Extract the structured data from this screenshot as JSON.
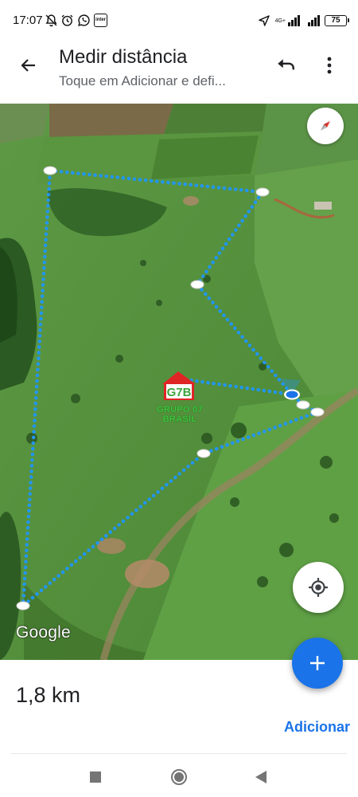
{
  "status_bar": {
    "time": "17:07",
    "network_tag": "4G+",
    "battery": "75",
    "left_icons": [
      "mute-bell-icon",
      "alarm-icon",
      "whatsapp-icon",
      "inter-app-icon"
    ],
    "inter_label": "inter"
  },
  "app_bar": {
    "title": "Medir distância",
    "subtitle": "Toque em Adicionar e defi..."
  },
  "map": {
    "google_label": "Google",
    "watermark_text": "GRUPO 07 BRASIL",
    "watermark_initials": "G7B",
    "path_color": "#2196f3"
  },
  "measurement": {
    "distance": "1,8 km",
    "add_label": "Adicionar"
  },
  "colors": {
    "accent": "#1a73e8",
    "text_primary": "#202124",
    "text_secondary": "#5f6368"
  }
}
